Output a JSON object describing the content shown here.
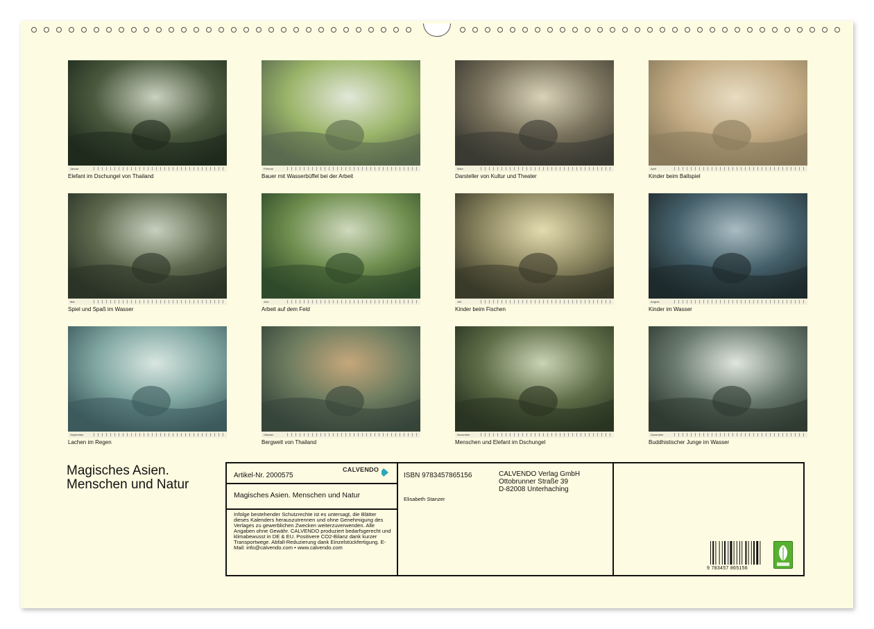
{
  "tiles": [
    {
      "month": "Januar",
      "caption": "Elefant im Dschungel von Thailand"
    },
    {
      "month": "Februar",
      "caption": "Bauer mit Wasserbüffel bei der Arbeit"
    },
    {
      "month": "März",
      "caption": "Darsteller von Kultur und Theater"
    },
    {
      "month": "April",
      "caption": "Kinder beim Ballspiel"
    },
    {
      "month": "Mai",
      "caption": "Spiel und Spaß im Wasser"
    },
    {
      "month": "Juni",
      "caption": "Arbeit auf dem Feld"
    },
    {
      "month": "Juli",
      "caption": "Kinder beim Fischen"
    },
    {
      "month": "August",
      "caption": "Kinder im Wasser"
    },
    {
      "month": "September",
      "caption": "Lachen im Regen"
    },
    {
      "month": "Oktober",
      "caption": "Bergwelt von Thailand"
    },
    {
      "month": "November",
      "caption": "Menschen und Elefant im Dschungel"
    },
    {
      "month": "Dezember",
      "caption": "Buddhistischer Junge im Wasser"
    }
  ],
  "calendar_title": {
    "line1": "Magisches Asien.",
    "line2": "Menschen und Natur"
  },
  "info_panel": {
    "article_no": "Artikel-Nr. 2000575",
    "brand": "CALVENDO",
    "product_title": "Magisches Asien. Menschen und Natur",
    "legal_text": "Infolge bestehender Schutzrechte ist es untersagt, die Blätter dieses Kalenders herauszutrennen und ohne Genehmigung des Verlages zu gewerblichen Zwecken weiterzuverwenden. Alle Angaben ohne Gewähr. CALVENDO produziert bedarfsgerecht und klimabewusst in DE & EU. Positivere CO2-Bilanz dank kurzer Transportwege. Abfall-Reduzierung dank Einzelstückfertigung. E-Mail: info@calvendo.com • www.calvendo.com",
    "isbn": "ISBN 9783457865156",
    "author": "Elisabeth Stanzer",
    "publisher_name": "CALVENDO Verlag GmbH",
    "publisher_street": "Ottobrunner Straße 39",
    "publisher_city": "D-82008 Unterhaching",
    "barcode_number": "9 783457 865156"
  },
  "colors": {
    "sheet": "#fdfbe1",
    "ink": "#111111",
    "eco_green": "#58b030",
    "logo_teal": "#2aa6b8"
  }
}
